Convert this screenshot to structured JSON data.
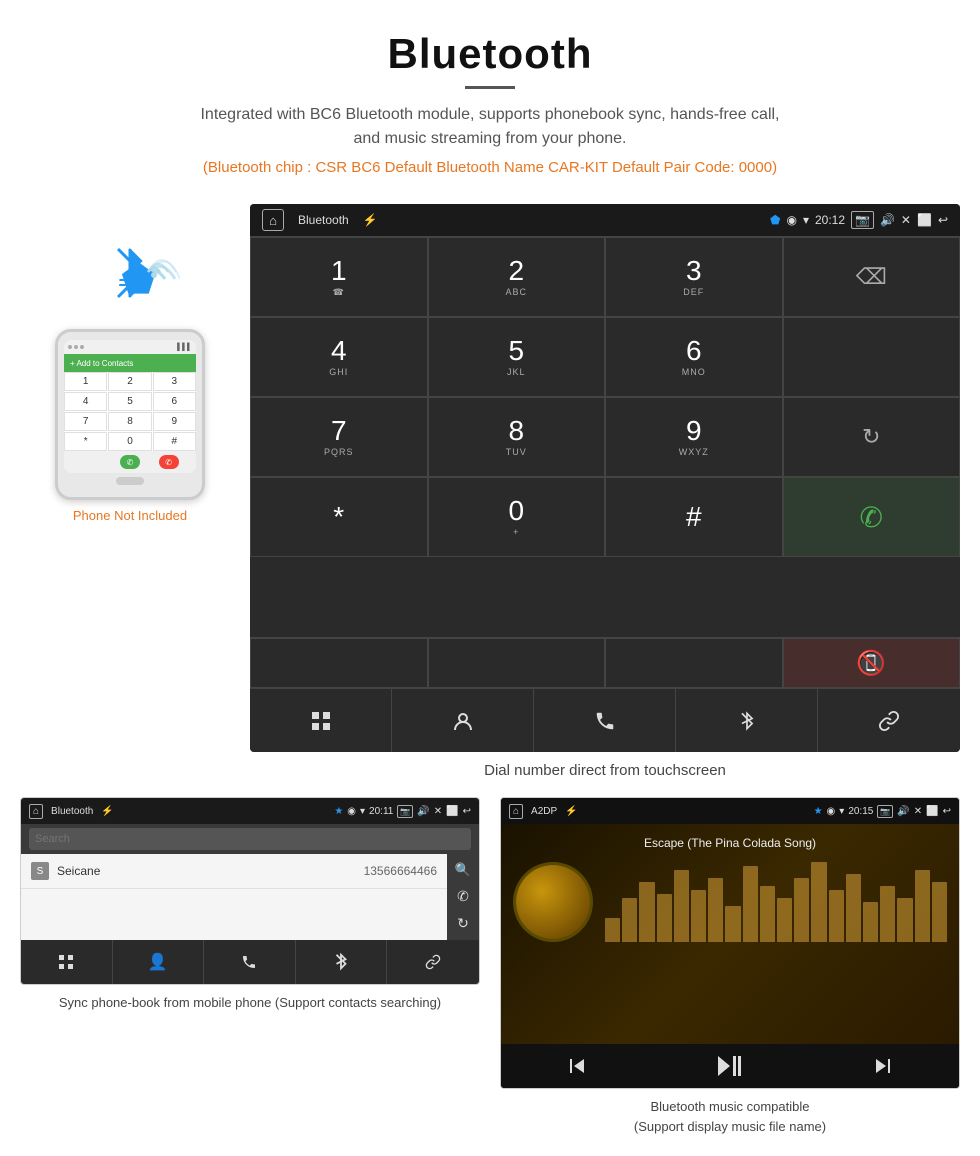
{
  "page": {
    "title": "Bluetooth",
    "subtitle": "Integrated with BC6 Bluetooth module, supports phonebook sync, hands-free call, and music streaming from your phone.",
    "specs": "(Bluetooth chip : CSR BC6    Default Bluetooth Name CAR-KIT    Default Pair Code: 0000)",
    "screen_caption": "Dial number direct from touchscreen",
    "phone_not_included": "Phone Not Included",
    "pb_caption": "Sync phone-book from mobile phone\n(Support contacts searching)",
    "music_caption": "Bluetooth music compatible\n(Support display music file name)"
  },
  "car_screen": {
    "status": {
      "app_name": "Bluetooth",
      "time": "20:12"
    },
    "dialpad": [
      {
        "main": "1",
        "sub": ""
      },
      {
        "main": "2",
        "sub": "ABC"
      },
      {
        "main": "3",
        "sub": "DEF"
      },
      {
        "main": "",
        "sub": "",
        "type": "empty"
      },
      {
        "main": "4",
        "sub": "GHI"
      },
      {
        "main": "5",
        "sub": "JKL"
      },
      {
        "main": "6",
        "sub": "MNO"
      },
      {
        "main": "",
        "sub": "",
        "type": "empty"
      },
      {
        "main": "7",
        "sub": "PQRS"
      },
      {
        "main": "8",
        "sub": "TUV"
      },
      {
        "main": "9",
        "sub": "WXYZ"
      },
      {
        "main": "",
        "sub": "",
        "type": "reload"
      },
      {
        "main": "*",
        "sub": ""
      },
      {
        "main": "0",
        "sub": "+"
      },
      {
        "main": "#",
        "sub": ""
      },
      {
        "main": "",
        "sub": "",
        "type": "call_green"
      },
      {
        "main": "",
        "sub": "",
        "type": "call_red"
      }
    ],
    "toolbar": {
      "items": [
        "grid",
        "person",
        "phone",
        "bluetooth",
        "link"
      ]
    }
  },
  "phonebook_screen": {
    "status": {
      "app_name": "Bluetooth",
      "time": "20:11"
    },
    "search_placeholder": "Search",
    "contacts": [
      {
        "letter": "S",
        "name": "Seicane",
        "number": "13566664466"
      }
    ],
    "toolbar": {
      "items": [
        "grid",
        "person",
        "phone",
        "bluetooth",
        "link"
      ]
    }
  },
  "music_screen": {
    "status": {
      "app_name": "A2DP",
      "time": "20:15"
    },
    "song_title": "Escape (The Pina Colada Song)",
    "visualizer_bars": [
      20,
      35,
      50,
      40,
      60,
      45,
      55,
      30,
      65,
      50,
      40,
      55,
      70,
      45,
      60,
      35,
      50,
      40,
      65,
      55
    ],
    "controls": {
      "prev": "⏮",
      "play_pause": "▶⏸",
      "next": "⏭"
    }
  },
  "phone_dialpad": {
    "keys": [
      "1",
      "2",
      "3",
      "4",
      "5",
      "6",
      "7",
      "8",
      "9",
      "*",
      "0",
      "#"
    ]
  }
}
